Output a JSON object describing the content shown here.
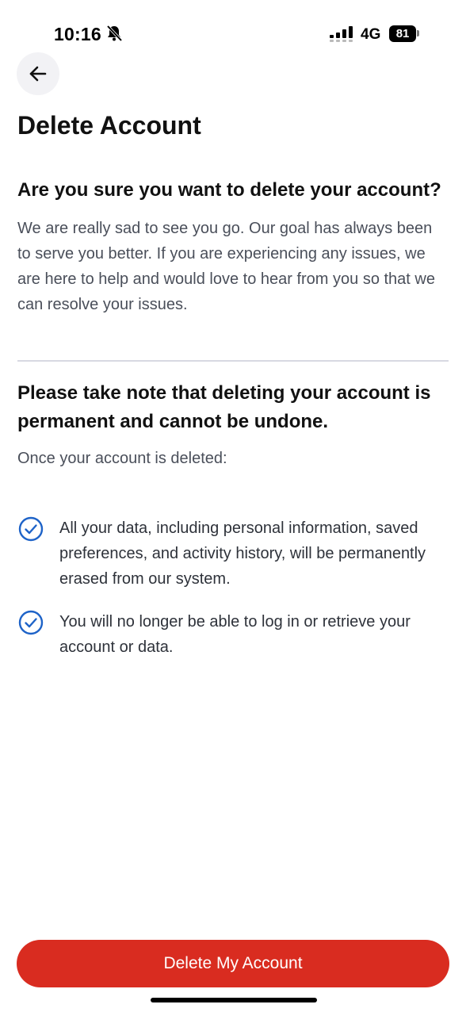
{
  "status_bar": {
    "time": "10:16",
    "network": "4G",
    "battery": "81",
    "icons": [
      "bell-slash-icon",
      "signal-icon",
      "battery-icon"
    ]
  },
  "header": {
    "back_icon": "arrow-left-icon",
    "title": "Delete Account"
  },
  "section_confirm": {
    "heading": "Are you sure you want to delete your account?",
    "body": "We are really sad to see you go. Our goal has always been to serve you better. If you are experiencing any issues, we are here to help and would love to hear from you so that we can resolve your issues."
  },
  "section_warning": {
    "heading": "Please take note that deleting your account is permanent and cannot be undone.",
    "intro": "Once your account is deleted:",
    "items": [
      {
        "icon": "check-circle-icon",
        "text": "All your data, including personal information, saved preferences, and activity history, will be permanently erased from our system."
      },
      {
        "icon": "check-circle-icon",
        "text": "You will no longer be able to log in or retrieve your account or data."
      }
    ]
  },
  "actions": {
    "delete_label": "Delete My Account"
  },
  "colors": {
    "accent_danger": "#d92c20",
    "check_blue": "#1e63c8",
    "body_text": "#4a4f5a"
  }
}
